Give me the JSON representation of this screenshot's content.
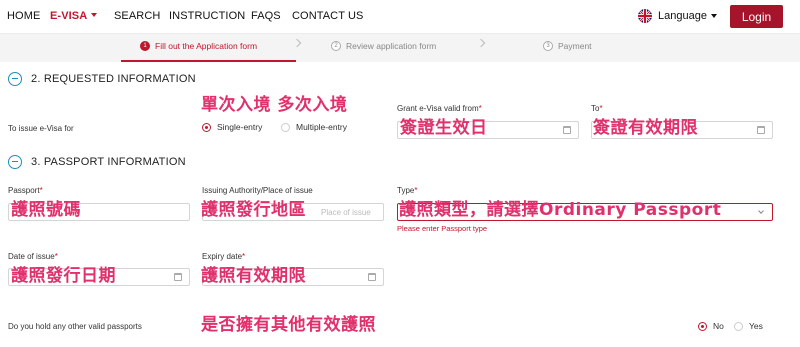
{
  "nav": {
    "items": [
      "HOME",
      "E-VISA",
      "SEARCH",
      "INSTRUCTION",
      "FAQS",
      "CONTACT US"
    ],
    "language": "Language",
    "login": "Login"
  },
  "steps": [
    {
      "num": "1",
      "label": "Fill out the Application form"
    },
    {
      "num": "2",
      "label": "Review application form"
    },
    {
      "num": "3",
      "label": "Payment"
    }
  ],
  "section2": {
    "title": "2. REQUESTED INFORMATION",
    "issue_label": "To issue e-Visa for",
    "single": "Single-entry",
    "multiple": "Multiple-entry",
    "valid_from_label": "Grant e-Visa valid from",
    "to_label": "To"
  },
  "section3": {
    "title": "3. PASSPORT INFORMATION",
    "passport_label": "Passport",
    "authority_label": "Issuing Authority/Place of issue",
    "authority_placeholder": "Place of issue",
    "type_label": "Type",
    "type_error": "Please enter Passport type",
    "date_issue_label": "Date of issue",
    "expiry_label": "Expiry date",
    "other_passports_label": "Do you hold any other valid passports",
    "no": "No",
    "yes": "Yes"
  },
  "required_mark": "*",
  "annotations": {
    "entry_types": "單次入境  多次入境",
    "valid_from": "簽證生效日",
    "valid_to": "簽證有效期限",
    "passport_no": "護照號碼",
    "issue_place": "護照發行地區",
    "passport_type": "護照類型，請選擇Ordinary Passport",
    "issue_date": "護照發行日期",
    "expiry": "護照有效期限",
    "other_passports": "是否擁有其他有效護照"
  },
  "colors": {
    "brand_red": "#c0172d",
    "login_red": "#a5142a",
    "annotation_pink": "#e1306c",
    "section_icon_blue": "#1f8fb8"
  }
}
